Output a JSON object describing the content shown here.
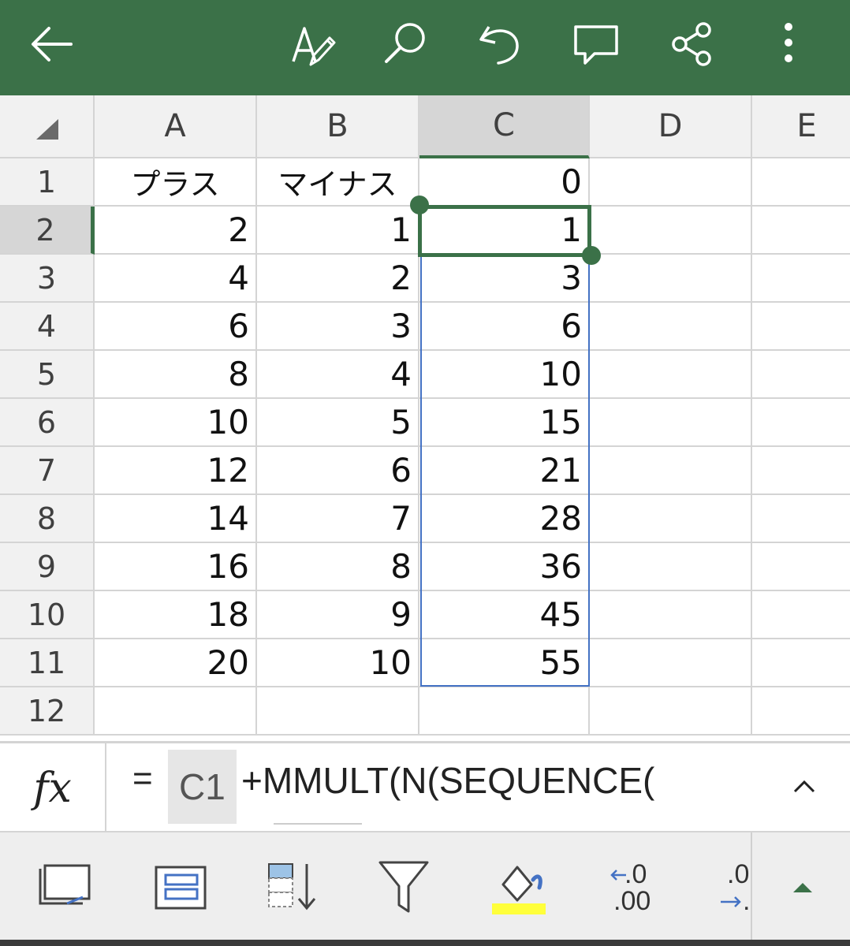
{
  "colors": {
    "topbar": "#3b7148",
    "selection_border": "#3b7148",
    "range_border": "#4472c4",
    "highlight": "#ffff3b"
  },
  "topbar": {
    "icons": [
      "back-arrow-icon",
      "edit-pen-icon",
      "search-icon",
      "undo-icon",
      "comment-icon",
      "share-icon",
      "more-vertical-icon"
    ]
  },
  "columns": [
    "A",
    "B",
    "C",
    "D",
    "E"
  ],
  "rows": [
    "1",
    "2",
    "3",
    "4",
    "5",
    "6",
    "7",
    "8",
    "9",
    "10",
    "11",
    "12"
  ],
  "selection": {
    "active_cell": "C2",
    "range": "C2:C11"
  },
  "cells": {
    "A": [
      "プラス",
      "2",
      "4",
      "6",
      "8",
      "10",
      "12",
      "14",
      "16",
      "18",
      "20",
      ""
    ],
    "B": [
      "マイナス",
      "1",
      "2",
      "3",
      "4",
      "5",
      "6",
      "7",
      "8",
      "9",
      "10",
      ""
    ],
    "C": [
      "0",
      "1",
      "3",
      "6",
      "10",
      "15",
      "21",
      "28",
      "36",
      "45",
      "55",
      ""
    ],
    "D": [
      "",
      "",
      "",
      "",
      "",
      "",
      "",
      "",
      "",
      "",
      "",
      ""
    ],
    "E": [
      "",
      "",
      "",
      "",
      "",
      "",
      "",
      "",
      "",
      "",
      "",
      ""
    ]
  },
  "formula_bar": {
    "fx_label": "fx",
    "equals": "=",
    "reference": "C1",
    "rest": "+MMULT(N(SEQUENCE(",
    "expand_icon": "chevron-up-icon"
  },
  "bottom_toolbar": {
    "icons": [
      "freeze-panes-icon",
      "wrap-text-icon",
      "sort-icon",
      "filter-icon",
      "fill-color-icon",
      "decrease-decimal-icon",
      "increase-decimal-icon",
      "expand-toolbar-icon"
    ],
    "decrease_decimal_top": "←.0",
    "decrease_decimal_bottom": ".00",
    "increase_decimal_top": ".0",
    "increase_decimal_bottom": "→."
  }
}
